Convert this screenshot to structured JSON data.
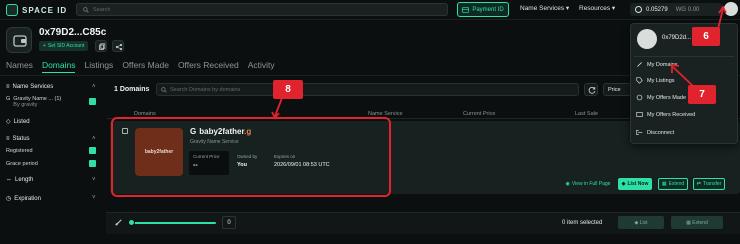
{
  "header": {
    "logo_text": "SPACE ID",
    "search_placeholder": "Search",
    "payment_btn": "Payment ID",
    "menu": [
      "Name Services",
      "Resources"
    ],
    "balance": "0.05279",
    "balance_alt": "WG 0.00"
  },
  "profile": {
    "name": "0x79D2...C85c",
    "set_sid_label": "Set SID Account"
  },
  "tabs": [
    "Names",
    "Domains",
    "Listings",
    "Offers Made",
    "Offers Received",
    "Activity"
  ],
  "sidebar": {
    "name_services_label": "Name Services",
    "gravity_label": "Gravity Name ...",
    "gravity_count": "(1)",
    "gravity_by": "By gravity",
    "listed_label": "Listed",
    "status_label": "Status",
    "status_registered": "Registered",
    "status_grace": "Grace period",
    "length_label": "Length",
    "expiration_label": "Expiration"
  },
  "domains": {
    "count_label": "1 Domains",
    "filter_placeholder": "Search Domains by domains",
    "sort_label": "Price",
    "columns": [
      "Domains",
      "Name Service",
      "Current Price",
      "Last Sale"
    ]
  },
  "row": {
    "thumb_text": "baby2father",
    "name": "baby2father",
    "suffix": ".g",
    "service": "Gravity Name Service",
    "price_label": "Current Price",
    "price_value": "--",
    "owned_label": "Owned by",
    "owned_value": "You",
    "expires_label": "Expires on",
    "expires_value": "2026/09/01  08:53 UTC",
    "view_full": "View in Full Page",
    "list_now": "List Now",
    "extend": "Extend",
    "transfer": "Transfer"
  },
  "bottom": {
    "slider_value": "0",
    "selected": "0 item selected",
    "list_btn": "List",
    "extend_btn": "Extend"
  },
  "dropdown": {
    "name": "0x79D2d...",
    "items": [
      "My Domains",
      "My Listings",
      "My Offers Made",
      "My Offers Received",
      "Disconnect"
    ]
  },
  "annotations": {
    "box_label": "8",
    "avatar_label": "6",
    "menu_label": "7"
  },
  "colors": {
    "accent": "#2fe0a6",
    "highlight": "#e0232c",
    "background": "#0b0f0f"
  }
}
